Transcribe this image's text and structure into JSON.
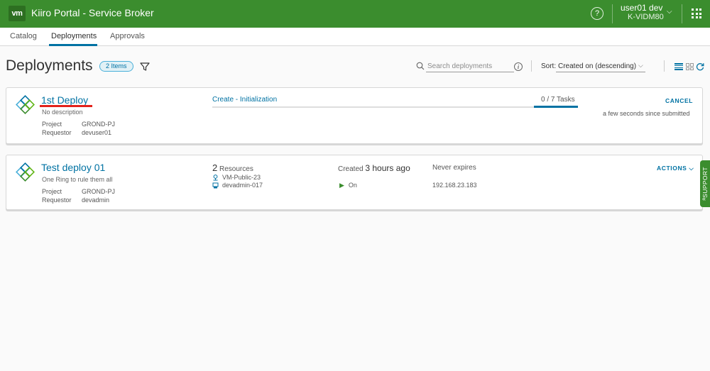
{
  "header": {
    "logo_text": "vm",
    "title": "Kiiro Portal - Service Broker",
    "help_icon": "?",
    "user_name": "user01 dev",
    "org": "K-VIDM80",
    "user_chevron": "⌵"
  },
  "nav": {
    "tabs": [
      {
        "label": "Catalog",
        "active": false
      },
      {
        "label": "Deployments",
        "active": true
      },
      {
        "label": "Approvals",
        "active": false
      }
    ]
  },
  "toolbar": {
    "page_title": "Deployments",
    "count_badge": "2 Items",
    "search_placeholder": "Search deployments",
    "info_icon": "i",
    "sort_label": "Sort:",
    "sort_value": "Created on (descending)",
    "sort_chevron": "⌵"
  },
  "deployments": [
    {
      "name": "1st Deploy",
      "description": "No description",
      "project_label": "Project",
      "project": "GROND-PJ",
      "requestor_label": "Requestor",
      "requestor": "devuser01",
      "step": "Create - Initialization",
      "tasks": "0 / 7  Tasks",
      "tasks_progress": 0,
      "cancel_label": "CANCEL",
      "submitted": "a few seconds since submitted"
    },
    {
      "name": "Test deploy 01",
      "description": "One Ring to rule them all",
      "project_label": "Project",
      "project": "GROND-PJ",
      "requestor_label": "Requestor",
      "requestor": "devadmin",
      "resource_count": "2",
      "resource_label": "Resources",
      "resources": [
        {
          "name": "VM-Public-23",
          "icon": "network-icon"
        },
        {
          "name": "devadmin-017",
          "icon": "vm-icon"
        }
      ],
      "created_prefix": "Created",
      "created_value": "3 hours ago",
      "power_state": "On",
      "power_icon": "▶",
      "expires": "Never expires",
      "ip": "192.168.23.183",
      "actions_label": "ACTIONS ⌵"
    }
  ],
  "support": {
    "label": "SUPPORT",
    "chevron": "«"
  },
  "colors": {
    "header_green": "#3b8d2e",
    "link_blue": "#0072a3",
    "highlight_red": "#e3221b"
  }
}
